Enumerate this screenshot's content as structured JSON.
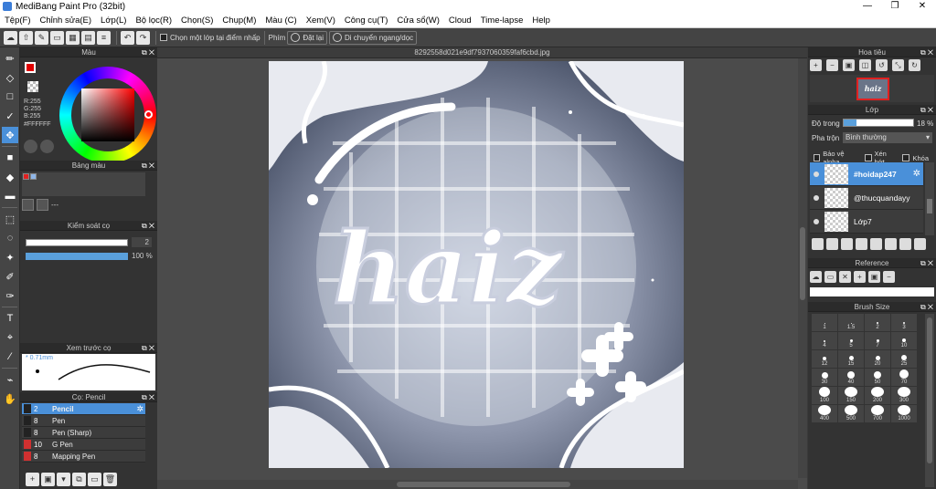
{
  "window": {
    "title": "MediBang Paint Pro (32bit)",
    "controls": [
      "—",
      "❐",
      "✕"
    ]
  },
  "menu": [
    "Tệp(F)",
    "Chỉnh sửa(E)",
    "Lớp(L)",
    "Bộ lọc(R)",
    "Chọn(S)",
    "Chụp(M)",
    "Màu (C)",
    "Xem(V)",
    "Công cụ(T)",
    "Cửa sổ(W)",
    "Cloud",
    "Time-lapse",
    "Help"
  ],
  "toolbar": {
    "select_layer_check": "Chọn một lớp tại điểm nhấp",
    "key_label": "Phím",
    "reset_label": "Đặt lại",
    "move_label": "Di chuyển ngang/dọc"
  },
  "color_panel": {
    "title": "Màu",
    "r": "R:255",
    "g": "G:255",
    "b": "B:255",
    "hex": "#FFFFFF"
  },
  "palette_panel": {
    "title": "Bảng màu",
    "dash": "---"
  },
  "brush_control": {
    "title": "Kiểm soát cọ",
    "size_value": "2",
    "opacity_value": "100 %",
    "opacity_percent": 100
  },
  "brush_preview": {
    "title": "Xem trước cọ",
    "size": "* 0.71mm"
  },
  "brush_list": {
    "title": "Cọ: Pencil",
    "items": [
      {
        "num": "2",
        "name": "Pencil",
        "color": "#222222"
      },
      {
        "num": "8",
        "name": "Pen",
        "color": "#222222"
      },
      {
        "num": "8",
        "name": "Pen (Sharp)",
        "color": "#222222"
      },
      {
        "num": "10",
        "name": "G Pen",
        "color": "#d03030"
      },
      {
        "num": "8",
        "name": "Mapping Pen",
        "color": "#d03030"
      }
    ]
  },
  "canvas": {
    "filename": "8292558d021e9df7937060359faf6cbd.jpg",
    "art_text": "haiz"
  },
  "navigator": {
    "title": "Hoa tiêu",
    "thumb_text": "haiz"
  },
  "layers": {
    "title": "Lớp",
    "opacity_label": "Độ trong",
    "opacity_value": "18 %",
    "opacity_percent": 18,
    "blend_label": "Pha trộn",
    "blend_value": "Bình thường",
    "check_alpha": "Bảo vệ alpha",
    "check_clip": "Xén bớt",
    "check_lock": "Khóa",
    "items": [
      {
        "name": "#hoidap247"
      },
      {
        "name": "@thucquandayy"
      },
      {
        "name": "Lớp7"
      }
    ]
  },
  "reference": {
    "title": "Reference"
  },
  "brush_size": {
    "title": "Brush Size",
    "sizes": [
      "1",
      "1.5",
      "2",
      "3",
      "4",
      "5",
      "7",
      "10",
      "12",
      "15",
      "20",
      "25",
      "30",
      "40",
      "50",
      "70",
      "100",
      "150",
      "200",
      "300",
      "400",
      "500",
      "700",
      "1000"
    ]
  },
  "colors": {
    "accent": "#4a90d9",
    "panel": "#333333",
    "foreground_color": "#e00000",
    "canvas_bg": "#4b4b4b"
  }
}
